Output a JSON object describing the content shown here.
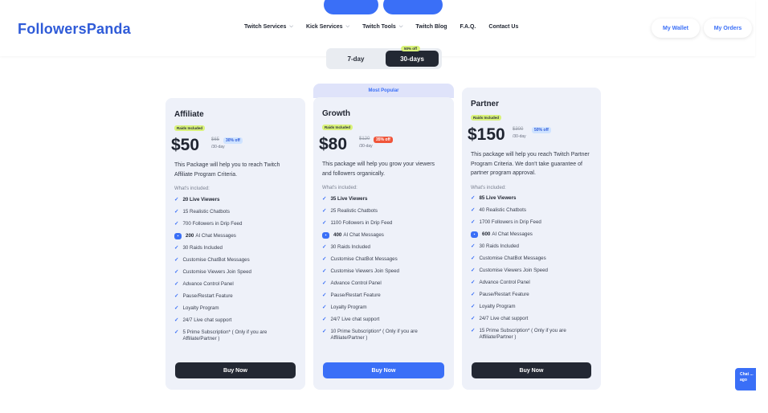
{
  "brand": {
    "name": "FollowersPanda",
    "color": "#2f5bd8",
    "accent": "#3a6ff7"
  },
  "nav": [
    {
      "label": "Twitch Services",
      "dropdown": true
    },
    {
      "label": "Kick Services",
      "dropdown": true
    },
    {
      "label": "Twitch Tools",
      "dropdown": true
    },
    {
      "label": "Twitch Blog",
      "dropdown": false
    },
    {
      "label": "F.A.Q.",
      "dropdown": false
    },
    {
      "label": "Contact Us",
      "dropdown": false
    }
  ],
  "header_buttons": {
    "wallet": "My Wallet",
    "orders": "My Orders"
  },
  "billing_toggle": {
    "options": [
      "7-day",
      "30-days"
    ],
    "selected": "30-days",
    "badge": "50% off"
  },
  "plans": [
    {
      "name": "Affiliate",
      "tag": "Raids Included",
      "price": "$50",
      "old_price": "$65",
      "discount": "30% off",
      "period": "/30-day",
      "description": "This Package will help you to reach Twitch Affiliate Program Criteria.",
      "included_label": "What's included:",
      "features": [
        "20 Live Viewers",
        "15 Realistic Chatbots",
        "700 Followers in Drip Feed",
        "200 AI Chat Messages",
        "30 Raids Included",
        "Customise ChatBot Messages",
        "Customise Viewers Join Speed",
        "Advance Control Panel",
        "Pause/Restart Feature",
        "Loyalty Program",
        "24/7 Live chat support",
        "5 Prime Subscription* ( Only if you are Affiliate/Partner )"
      ],
      "cta": "Buy Now"
    },
    {
      "name": "Growth",
      "banner": "Most Popular",
      "tag": "Raids Included",
      "price": "$80",
      "old_price": "$120",
      "discount": "35% off",
      "period": "/30-day",
      "description": "This package will help you grow your viewers and followers organically.",
      "included_label": "What's included:",
      "features": [
        "35 Live Viewers",
        "25 Realistic Chatbots",
        "1100 Followers in Drip Feed",
        "400 AI Chat Messages",
        "30 Raids Included",
        "Customise ChatBot Messages",
        "Customise Viewers Join Speed",
        "Advance Control Panel",
        "Pause/Restart Feature",
        "Loyalty Program",
        "24/7 Live chat support",
        "10 Prime Subscription* ( Only if you are Affiliate/Partner )"
      ],
      "cta": "Buy Now"
    },
    {
      "name": "Partner",
      "tag": "Raids Included",
      "price": "$150",
      "old_price": "$300",
      "discount": "50% off",
      "period": "/30-day",
      "description": "This package will help you reach Twitch Partner Program Criteria. We don't take guarantee of partner program approval.",
      "included_label": "What's included:",
      "features": [
        "85 Live Viewers",
        "40 Realistic Chatbots",
        "1700 Followers in Drip Feed",
        "600 AI Chat Messages",
        "30 Raids Included",
        "Customise ChatBot Messages",
        "Customise Viewers Join Speed",
        "Advance Control Panel",
        "Pause/Restart Feature",
        "Loyalty Program",
        "24/7 Live chat support",
        "15 Prime Subscription* ( Only if you are Affiliate/Partner )"
      ],
      "cta": "Buy Now"
    }
  ],
  "chat_widget": {
    "label": "Chat ... ago"
  },
  "icons": {
    "check": "check-icon",
    "ai_chat": "ai-chat-icon",
    "dropdown": "chevron-down-icon"
  }
}
